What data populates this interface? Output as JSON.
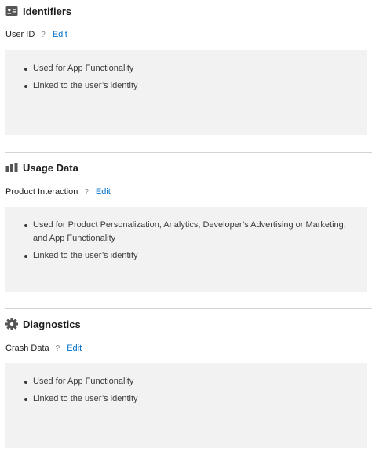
{
  "sections": [
    {
      "title": "Identifiers",
      "icon": "id-card-icon",
      "data_type": "User ID",
      "help": "?",
      "edit_label": "Edit",
      "bullets": [
        "Used for App Functionality",
        "Linked to the user’s identity"
      ]
    },
    {
      "title": "Usage Data",
      "icon": "bar-chart-icon",
      "data_type": "Product Interaction",
      "help": "?",
      "edit_label": "Edit",
      "bullets": [
        "Used for Product Personalization, Analytics, Developer’s Advertising or Marketing, and App Functionality",
        "Linked to the user’s identity"
      ]
    },
    {
      "title": "Diagnostics",
      "icon": "gear-icon",
      "data_type": "Crash Data",
      "help": "?",
      "edit_label": "Edit",
      "bullets": [
        "Used for App Functionality",
        "Linked to the user’s identity"
      ]
    }
  ]
}
